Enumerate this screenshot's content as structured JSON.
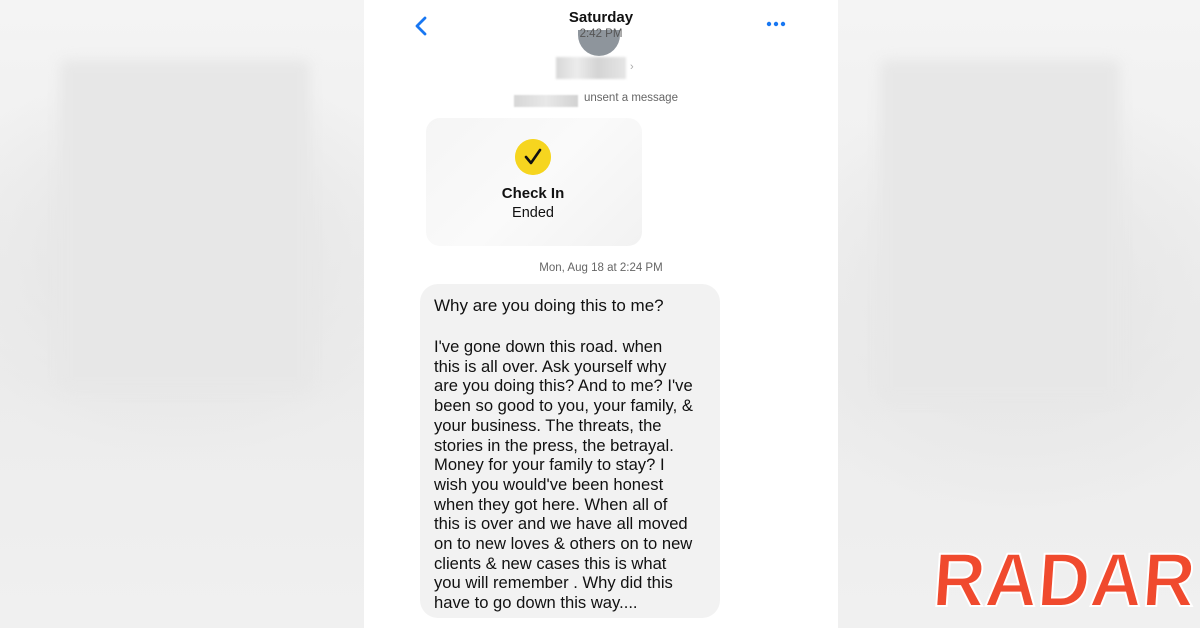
{
  "header": {
    "day": "Saturday",
    "time": "2:42 PM"
  },
  "system_notice": {
    "text": "unsent a message"
  },
  "check_in": {
    "title": "Check In",
    "status": "Ended",
    "icon": "checkmark-icon",
    "icon_color": "#f6d51f"
  },
  "date_stamp": "Mon, Aug 18 at 2:24 PM",
  "message": {
    "first_line": "Why are you doing this to me?",
    "body": "I've gone down this road. when\nthis is all over. Ask yourself why\nare you doing this? And to me? I've\nbeen so good to you, your family, &\nyour business. The threats, the\nstories in the press, the betrayal.\nMoney for your family to stay? I\nwish you would've been honest\nwhen they got here. When all of\nthis is over and we have all moved\non to new loves & others on to new\nclients & new cases this is what\nyou will remember . Why did this\nhave to go down this way...."
  },
  "watermark": {
    "text": "RADAR",
    "color": "#f04a2e"
  },
  "colors": {
    "accent": "#1877f2",
    "bubble": "#f2f2f2"
  }
}
